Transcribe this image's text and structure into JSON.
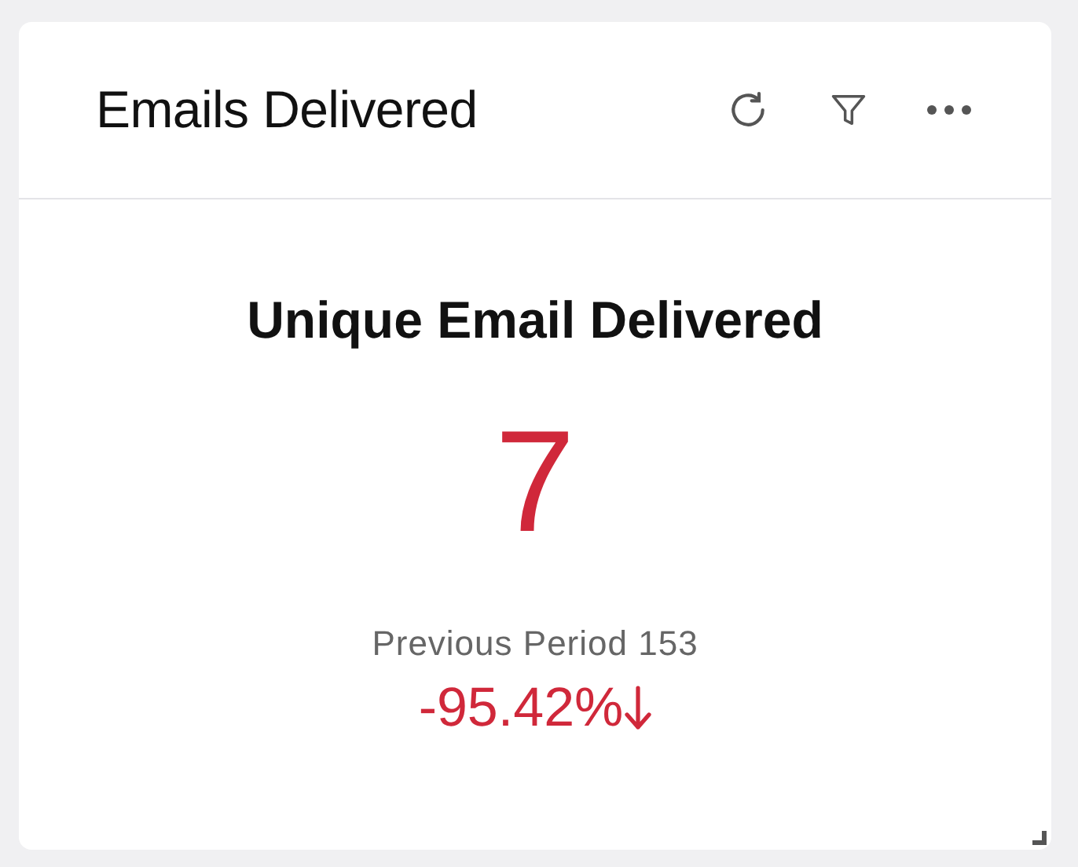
{
  "card": {
    "title": "Emails Delivered"
  },
  "metric": {
    "label": "Unique Email Delivered",
    "value": "7",
    "previous": "Previous Period 153",
    "change": "-95.42%",
    "decreased": true
  }
}
